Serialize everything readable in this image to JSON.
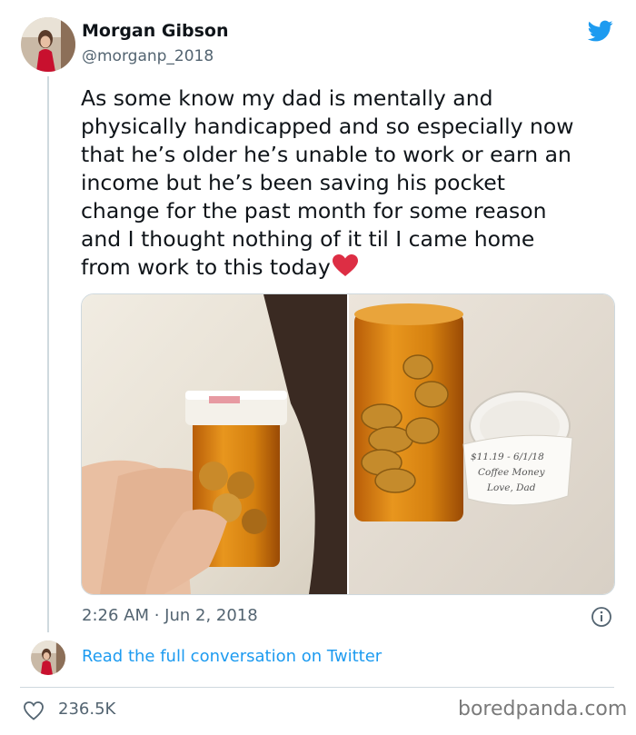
{
  "tweet": {
    "author_name": "Morgan Gibson",
    "author_handle": "@morganp_2018",
    "text_lines": [
      "As some know my dad is mentally and",
      "physically handicapped and so especially now",
      "that he’s older he’s unable to work or earn an",
      "income but he’s been saving his pocket",
      "change for the past month for some reason",
      "and I thought nothing of it til I came home",
      "from work to this today"
    ],
    "emoji": "red-heart",
    "timestamp": "2:26 AM · Jun 2, 2018",
    "read_link": "Read the full conversation on Twitter",
    "likes": "236.5K",
    "note_text": [
      "$11.19 - 6/1/18",
      "Coffee Money",
      "Love, Dad"
    ]
  },
  "watermark": "boredpanda.com",
  "colors": {
    "link": "#1d9bf0",
    "twitter_blue": "#1d9bf0",
    "muted": "#536471",
    "heart": "#e0245e"
  },
  "icons": {
    "logo": "twitter-bird-icon",
    "info": "info-icon",
    "like": "heart-outline-icon"
  }
}
